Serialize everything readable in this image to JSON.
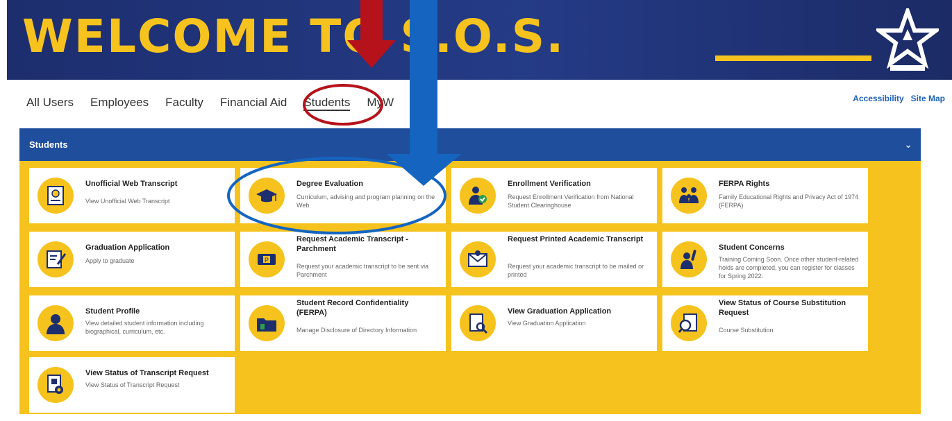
{
  "banner": {
    "title": "WELCOME TO S.O.S."
  },
  "nav": [
    "All Users",
    "Employees",
    "Faculty",
    "Financial Aid",
    "Students",
    "MyW"
  ],
  "utility": [
    "Accessibility",
    "Site Map"
  ],
  "panel": {
    "title": "Students",
    "collapse_icon": "chevron-down-icon"
  },
  "cards": [
    {
      "title": "Unofficial Web Transcript",
      "desc": "View Unofficial Web Transcript",
      "icon": "certificate-icon"
    },
    {
      "title": "Degree Evaluation",
      "desc": "Curriculum, advising and program planning on the Web.",
      "icon": "graduation-cap-icon"
    },
    {
      "title": "Enrollment Verification",
      "desc": "Request Enrollment Verification from National Student Clearinghouse",
      "icon": "verified-user-icon"
    },
    {
      "title": "FERPA Rights",
      "desc": "Family Educational Rights and Privacy Act of 1974 (FERPA)",
      "icon": "family-icon"
    },
    {
      "title": "Graduation Application",
      "desc": "Apply to graduate",
      "icon": "form-edit-icon"
    },
    {
      "title": "Request Academic Transcript - Parchment",
      "desc": "Request your academic transcript to be sent via Parchment",
      "icon": "parchment-icon"
    },
    {
      "title": "Request Printed Academic Transcript",
      "desc": "Request your academic transcript to be mailed or printed",
      "icon": "envelope-icon"
    },
    {
      "title": "Student Concerns",
      "desc": "Training Coming Soon. Once other student-related holds are completed, you can register for classes for Spring 2022.",
      "icon": "raised-hand-icon"
    },
    {
      "title": "Student Profile",
      "desc": "View detailed student information including biographical, curriculum, etc.",
      "icon": "user-profile-icon"
    },
    {
      "title": "Student Record Confidentiality (FERPA)",
      "desc": "Manage Disclosure of Directory Information",
      "icon": "folder-icon"
    },
    {
      "title": "View Graduation Application",
      "desc": "View Graduation Application",
      "icon": "document-search-icon"
    },
    {
      "title": "View Status of Course Substitution Request",
      "desc": "Course Substitution",
      "icon": "document-magnify-icon"
    },
    {
      "title": "View Status of Transcript Request",
      "desc": "View Status of Transcript Request",
      "icon": "document-gear-icon"
    }
  ],
  "colors": {
    "banner": "#1d2e6e",
    "gold": "#f6c31e",
    "panel_header": "#1f4e9c",
    "link": "#1f63b8",
    "arrow_red": "#b5121b",
    "arrow_blue": "#1565c0"
  }
}
